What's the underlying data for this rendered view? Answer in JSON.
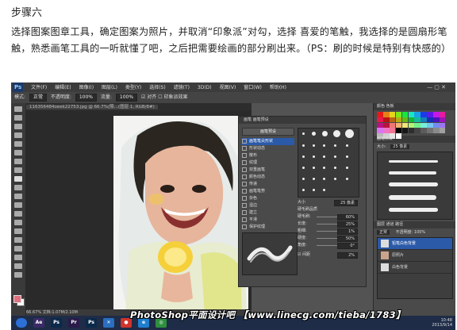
{
  "article": {
    "step_title": "步骤六",
    "paragraph": "选择图案图章工具，确定图案为照片，并取消“印象派”对勾，选择 喜爱的笔触，我选择的是圆扇形笔触，熟悉画笔工具的一听就懂了吧，之后把需要绘画的部分刷出来。（PS：刷的时候是特别有快感的）"
  },
  "photoshop": {
    "app_logo": "Ps",
    "menu": [
      "文件(F)",
      "编辑(E)",
      "图像(I)",
      "图层(L)",
      "类型(Y)",
      "选择(S)",
      "滤镜(T)",
      "3D(D)",
      "视图(V)",
      "窗口(W)",
      "帮助(H)"
    ],
    "window_controls": "— ▢ ✕",
    "options": {
      "mode_label": "模式:",
      "mode_value": "正常",
      "opacity_label": "不透明度:",
      "opacity_value": "100%",
      "flow_label": "流量:",
      "flow_value": "100%",
      "align_label": "对齐",
      "impressionist_label": "印象派效果"
    },
    "document_tab": "116356484oeek22753.jpg @ 66.7%(照...(图层 1, RGB/8#)",
    "status": "66.67%   文档:1.07M/2.10M",
    "brush_panel": {
      "tabs": "画笔  画笔预设",
      "preset_button": "画笔预设",
      "items": [
        {
          "label": "画笔笔尖形状",
          "selected": true
        },
        {
          "label": "形状动态",
          "selected": false
        },
        {
          "label": "散布",
          "selected": false
        },
        {
          "label": "纹理",
          "selected": false
        },
        {
          "label": "双重画笔",
          "selected": false
        },
        {
          "label": "颜色动态",
          "selected": false
        },
        {
          "label": "传递",
          "selected": false
        },
        {
          "label": "画笔笔势",
          "selected": false
        },
        {
          "label": "杂色",
          "selected": false
        },
        {
          "label": "湿边",
          "selected": false
        },
        {
          "label": "建立",
          "selected": false
        },
        {
          "label": "平滑",
          "selected": false
        },
        {
          "label": "保护纹理",
          "selected": false
        }
      ],
      "size_label": "大小",
      "size_value": "25 像素",
      "settings_title": "硬毛刷品质",
      "settings": [
        {
          "label": "硬毛刷:",
          "value": "60%"
        },
        {
          "label": "长度:",
          "value": "25%"
        },
        {
          "label": "粗细:",
          "value": "1%"
        },
        {
          "label": "硬度:",
          "value": "50%"
        },
        {
          "label": "角度:",
          "value": "0°"
        }
      ],
      "spacing_label": "间距",
      "spacing_value": "2%"
    },
    "right_panels": {
      "swatches_tab": "颜色  色板",
      "presets_tab": "画笔预设",
      "presets_size_label": "大小:",
      "presets_size_value": "25 像素",
      "layers_tab": "图层  通道  路径",
      "layers_mode": "正常",
      "layers_opacity": "不透明度: 100%",
      "layers": [
        {
          "name": "铅笔白色背景",
          "selected": true
        },
        {
          "name": "原照片",
          "selected": false
        },
        {
          "name": "白色背景",
          "selected": false
        }
      ]
    },
    "taskbar": {
      "apps": [
        "Ae",
        "Ps",
        "Pr",
        "Ps",
        "✕",
        "●",
        "e",
        "◎"
      ],
      "clock_time": "10:48",
      "clock_date": "2013/9/14"
    }
  },
  "watermark": "PhotoShop平面设计吧 【www.linecg.com/tieba/1783】",
  "colors": {
    "ps_background": "#535353",
    "panel": "#4a4a4a",
    "selection_blue": "#2b5aa8",
    "taskbar": "#1e2c48"
  }
}
